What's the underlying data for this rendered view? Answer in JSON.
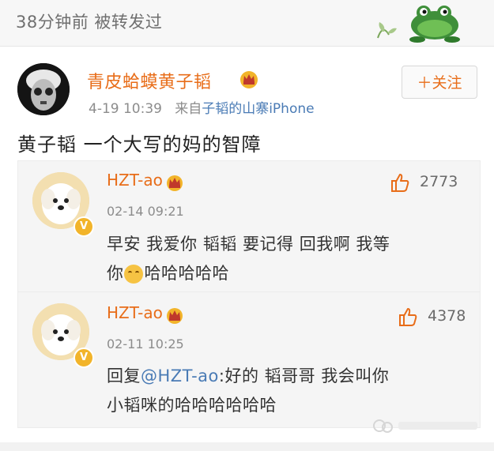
{
  "header": {
    "repost_meta": "38分钟前 被转发过"
  },
  "post": {
    "author": "青皮蛤蟆黄子韬",
    "date": "4-19 10:39",
    "source_prefix": "来自",
    "source": "子韬的山寨iPhone",
    "follow_label": "＋关注",
    "text": "黄子韬 一个大写的妈的智障"
  },
  "comments": [
    {
      "name": "HZT-ao",
      "time": "02-14 09:21",
      "likes": "2773",
      "text_line1": "早安 我爱你 韬韬 要记得 回我啊 我等",
      "text_line2_pre": "你",
      "text_line2_post": "哈哈哈哈哈"
    },
    {
      "name": "HZT-ao",
      "time": "02-11 10:25",
      "likes": "4378",
      "reply_prefix": "回复",
      "mention": "@HZT-ao",
      "text_line1_rest": ":好的 韬哥哥 我会叫你",
      "text_line2": "小韬咪的哈哈哈哈哈哈"
    }
  ],
  "icons": {
    "crown": "crown-icon",
    "like": "thumbs-up-icon",
    "verified": "verified-badge-icon",
    "emoji": "smile-emoji-icon",
    "frog": "frog-icon"
  },
  "colors": {
    "name_orange": "#e86d19",
    "link_blue": "#4a7bb5",
    "crown_gold": "#f2b42a"
  }
}
